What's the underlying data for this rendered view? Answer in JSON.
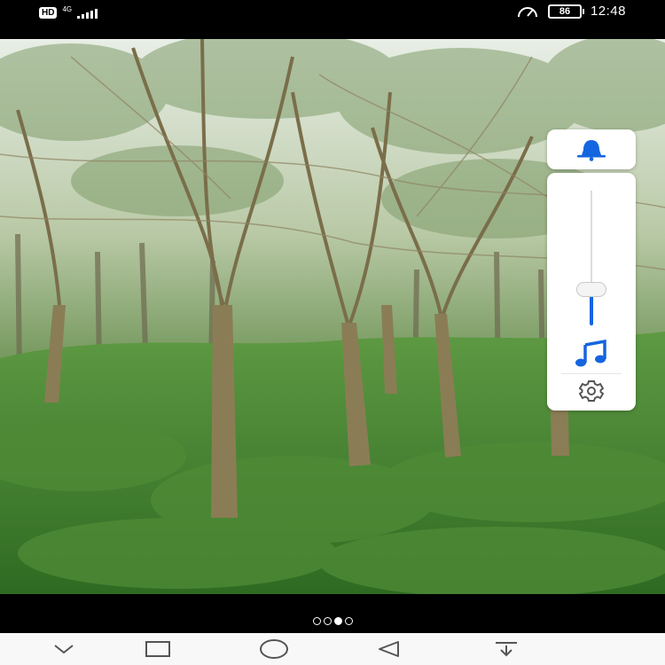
{
  "status_bar": {
    "hd_label": "HD",
    "network_type": "4G",
    "battery_level": "86",
    "time": "12:48"
  },
  "volume_panel": {
    "ringer_icon": "bell-icon",
    "slider_level_fraction": 0.26,
    "media_icon": "music-note-icon",
    "settings_icon": "gear-icon"
  },
  "page_indicator": {
    "total": 4,
    "active_index": 2
  },
  "navigation": {
    "buttons": [
      "chevron-down-icon",
      "square-icon",
      "home-circle-icon",
      "back-triangle-icon",
      "notification-pulldown-icon"
    ]
  },
  "colors": {
    "accent": "#1565e0",
    "panel_bg": "#ffffff",
    "nav_bg": "#f8f8f8"
  }
}
